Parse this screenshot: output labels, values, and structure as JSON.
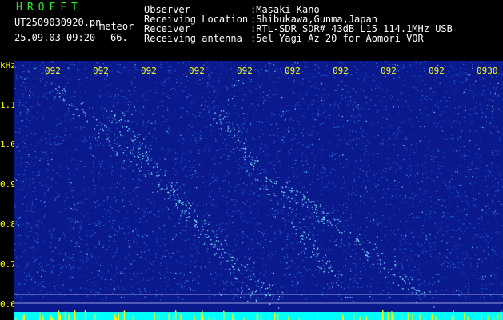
{
  "app": {
    "title": "HROFFT",
    "file_name": "UT2509030920.pn",
    "mode": "meteor",
    "datetime": "25.09.03 09:20",
    "count": "66."
  },
  "info": {
    "labels": [
      "Observer",
      "Receiving Location",
      "Receiver",
      "Receiving antenna"
    ],
    "values": [
      ":Masaki Kano",
      ":Shibukawa,Gunma,Japan",
      ":RTL-SDR SDR# 43dB L15 114.1MHz USB",
      ":5el Yagi Az 20 for Aomori VOR"
    ]
  },
  "spectrogram": {
    "unit": "kHz",
    "y_ticks": [
      "1.1",
      "1.0",
      "0.9",
      "0.8",
      "0.7",
      "0.6"
    ],
    "time_ticks": [
      "092",
      "092",
      "092",
      "092",
      "092",
      "092",
      "092",
      "092",
      "092",
      "0930"
    ],
    "colors": {
      "background": "#0a1a8c",
      "noise": "#2a7bff",
      "signal": "#7ff0ff",
      "baseline": "#00ffff",
      "bursts": "#ffff00"
    }
  }
}
